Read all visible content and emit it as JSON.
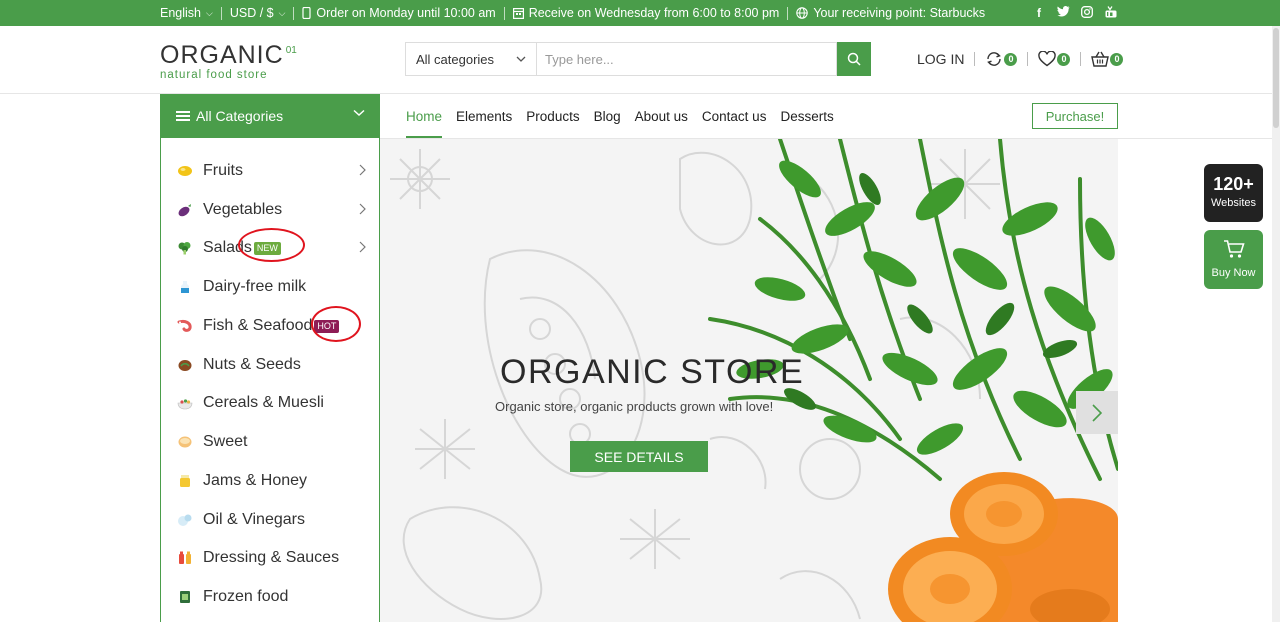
{
  "topbar": {
    "language": "English",
    "currency": "USD / $",
    "order_info": "Order on Monday until 10:00 am",
    "receive_info": "Receive on Wednesday from 6:00 to 8:00 pm",
    "receiving_point": "Your receiving point: Starbucks",
    "social": [
      "facebook-icon",
      "twitter-icon",
      "instagram-icon",
      "youtube-icon"
    ]
  },
  "logo": {
    "brand": "ORGANIC",
    "suffix": "01",
    "tagline": "natural food store"
  },
  "search": {
    "category": "All categories",
    "placeholder": "Type here..."
  },
  "header": {
    "login": "LOG IN",
    "compare_count": "0",
    "wishlist_count": "0",
    "cart_count": "0"
  },
  "nav": {
    "all_categories": "All Categories",
    "items": [
      "Home",
      "Elements",
      "Products",
      "Blog",
      "About us",
      "Contact us",
      "Desserts"
    ],
    "purchase": "Purchase!"
  },
  "sidebar": {
    "items": [
      {
        "label": "Fruits"
      },
      {
        "label": "Vegetables"
      },
      {
        "label": "Salads",
        "tag": "NEW"
      },
      {
        "label": "Dairy-free milk"
      },
      {
        "label": "Fish & Seafood",
        "tag": "HOT"
      },
      {
        "label": "Nuts & Seeds"
      },
      {
        "label": "Cereals & Muesli"
      },
      {
        "label": "Sweet"
      },
      {
        "label": "Jams & Honey"
      },
      {
        "label": "Oil & Vinegars"
      },
      {
        "label": "Dressing & Sauces"
      },
      {
        "label": "Frozen food"
      }
    ]
  },
  "hero": {
    "title": "ORGANIC STORE",
    "subtitle": "Organic store, organic products grown with love!",
    "button": "SEE DETAILS"
  },
  "float": {
    "websites_count": "120+",
    "websites_label": "Websites",
    "buy_now": "Buy Now"
  },
  "colors": {
    "accent": "#4a9d4a",
    "hot": "#8e1c55",
    "new": "#6cab3e",
    "annotation": "#e0141e"
  }
}
